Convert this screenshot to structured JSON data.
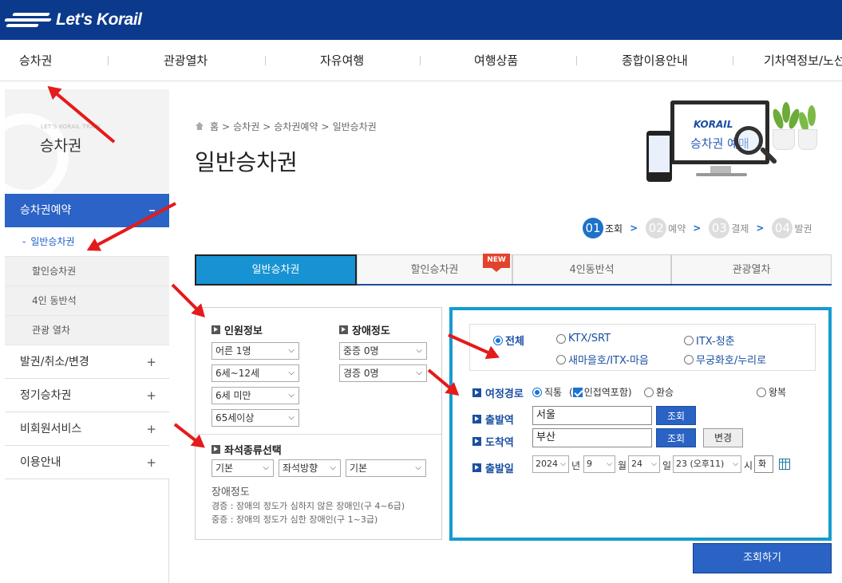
{
  "header": {
    "logo_text": "Let's Korail",
    "brand_color": "#0b3a8c"
  },
  "gnb": {
    "items": [
      "승차권",
      "관광열차",
      "자유여행",
      "여행상품",
      "종합이용안내",
      "기차역정보/노선"
    ]
  },
  "lnb": {
    "sub_title": "LET'S KORAIL TRAIN",
    "title": "승차권",
    "active": "승차권예약",
    "sub_items": [
      "일반승차권",
      "할인승차권",
      "4인 동반석",
      "관광 열차"
    ],
    "main_items": [
      "발권/취소/변경",
      "정기승차권",
      "비회원서비스",
      "이용안내"
    ],
    "plus": "+"
  },
  "breadcrumb": [
    "홈",
    "승차권",
    "승차권예약",
    "일반승차권"
  ],
  "page_title": "일반승차권",
  "illustration": {
    "logo": "KORAIL",
    "text": "승차권 예매"
  },
  "steps": [
    {
      "num": "01",
      "label": "조회",
      "active": true
    },
    {
      "num": "02",
      "label": "예약",
      "active": false
    },
    {
      "num": "03",
      "label": "결제",
      "active": false
    },
    {
      "num": "04",
      "label": "발권",
      "active": false
    }
  ],
  "tabs": [
    "일반승차권",
    "할인승차권",
    "4인동반석",
    "관광열차"
  ],
  "new_badge": "NEW",
  "passenger": {
    "title": "인원정보",
    "selects": [
      "어른 1명",
      "6세~12세",
      "6세 미만",
      "65세이상"
    ]
  },
  "disability": {
    "title": "장애정도",
    "selects": [
      "중증 0명",
      "경증 0명"
    ]
  },
  "seat": {
    "title": "좌석종류선택",
    "selects": [
      "기본",
      "좌석방향",
      "기본"
    ]
  },
  "notes": {
    "title": "장애정도",
    "lines": [
      "경증 : 장애의 정도가 심하지 않은 장애인(구 4~6급)",
      "중증 : 장애의 정도가 심한 장애인(구 1~3급)"
    ]
  },
  "train_types": [
    {
      "label": "전체",
      "selected": true
    },
    {
      "label": "KTX/SRT",
      "selected": false
    },
    {
      "label": "ITX-청춘",
      "selected": false
    },
    {
      "label": "새마을호/ITX-마음",
      "selected": false
    },
    {
      "label": "무궁화호/누리로",
      "selected": false
    }
  ],
  "route": {
    "label": "여정경로",
    "options": [
      "직통",
      "인접역포함",
      "환승",
      "왕복"
    ],
    "adjacent_checked": true
  },
  "departure": {
    "label": "출발역",
    "value": "서울",
    "button": "조회"
  },
  "arrival": {
    "label": "도착역",
    "value": "부산",
    "button": "조회",
    "swap": "변경"
  },
  "date": {
    "label": "출발일",
    "year": "2024",
    "year_unit": "년",
    "month": "9",
    "month_unit": "월",
    "day": "24",
    "day_unit": "일",
    "hour": "23 (오후11)",
    "hour_unit": "시",
    "weekday": "화"
  },
  "search_button": "조회하기",
  "colors": {
    "accent": "#2a63c4",
    "tab_active": "#1793d3",
    "box_border": "#169bcf",
    "annotation": "#e51a1a"
  }
}
